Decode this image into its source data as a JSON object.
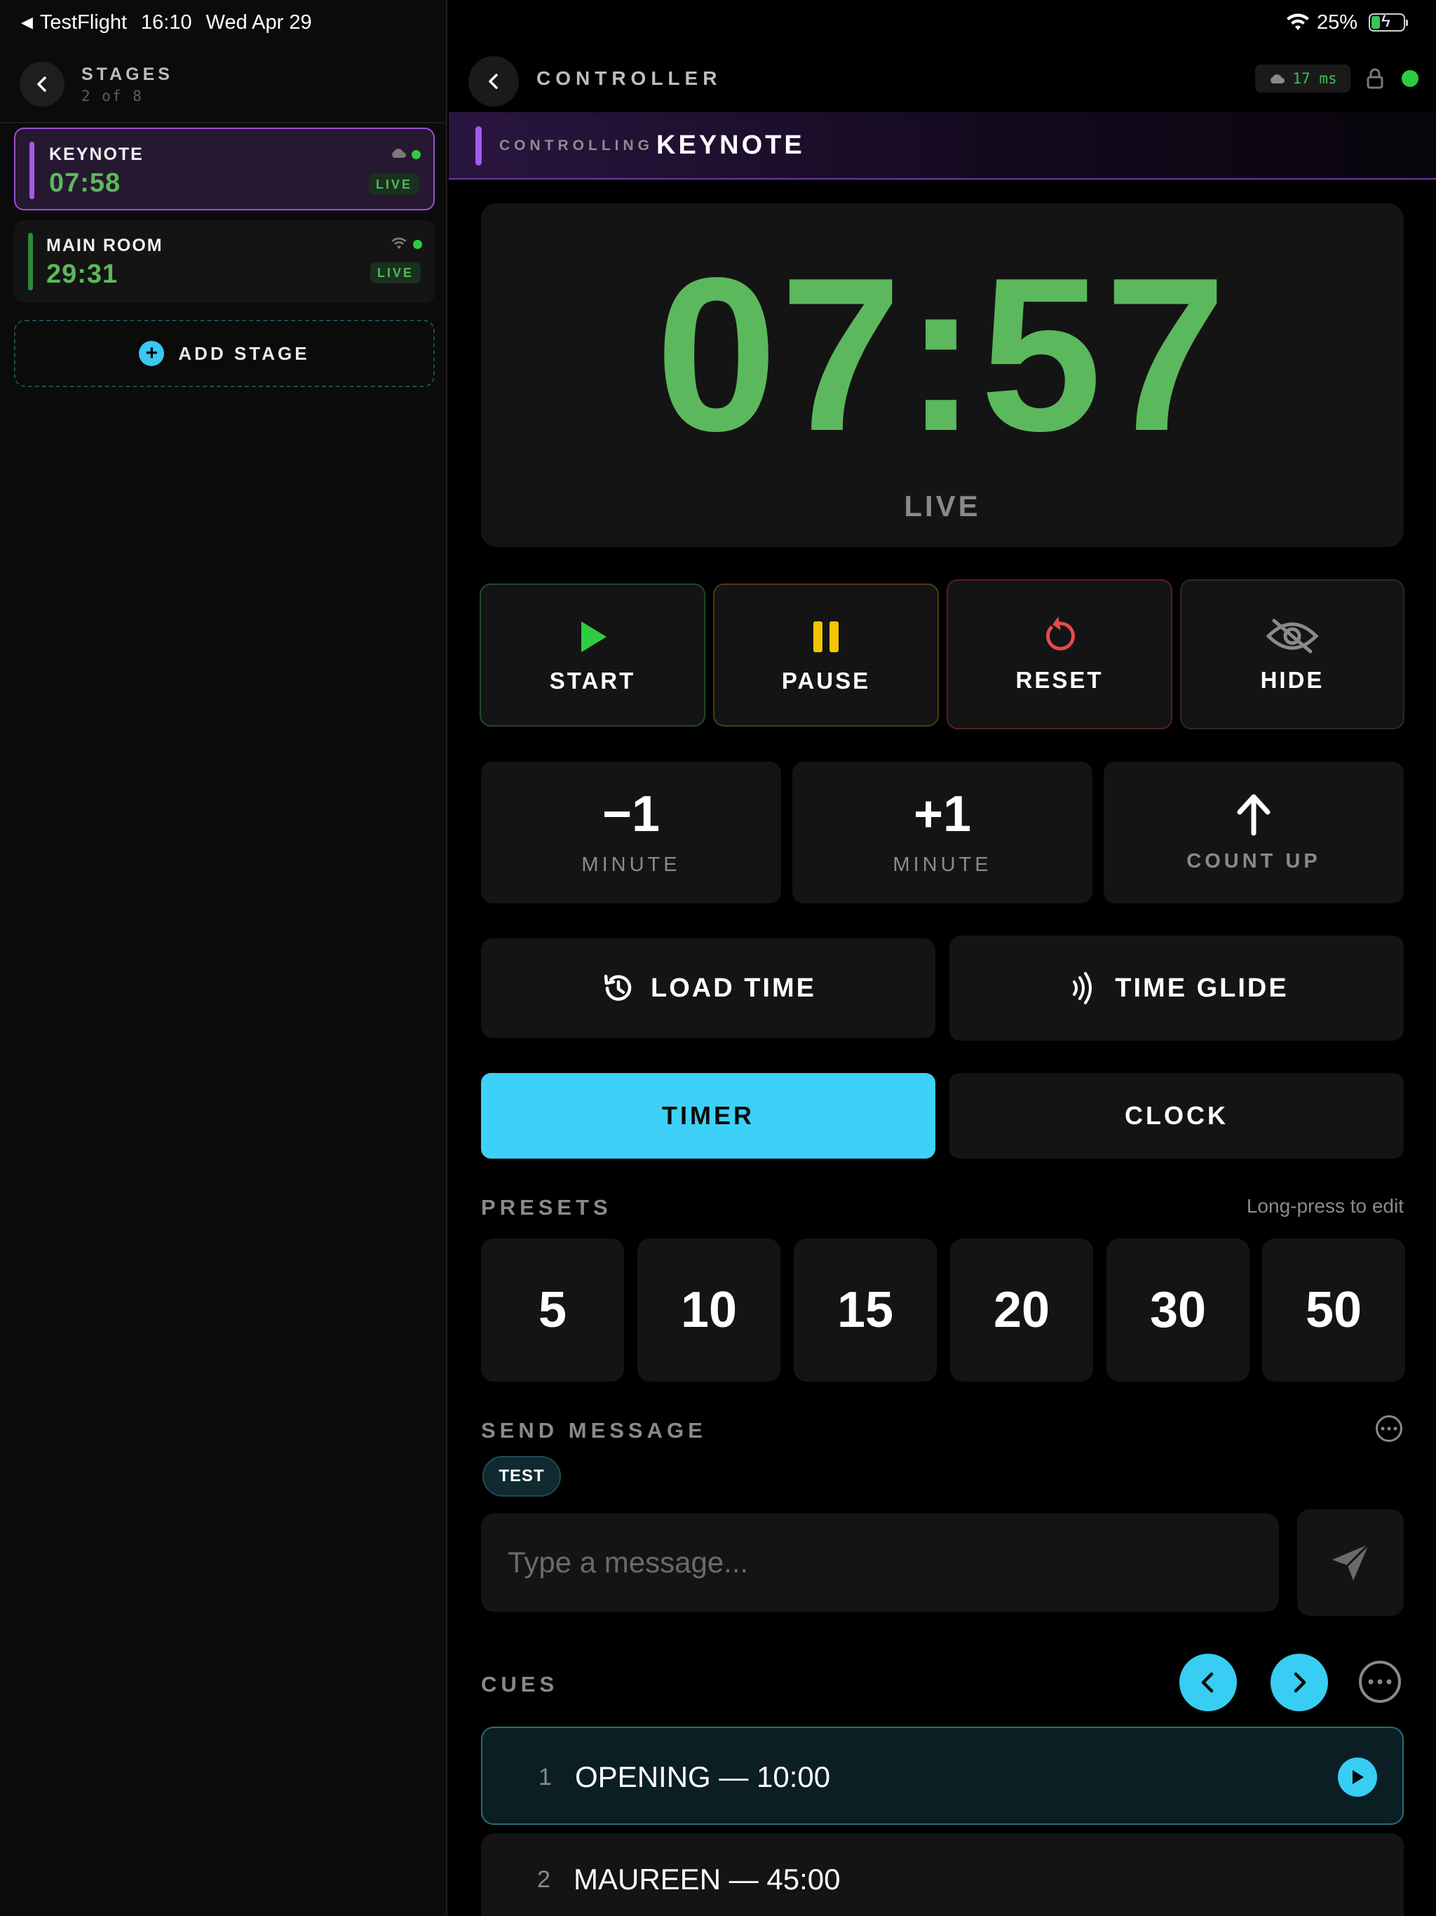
{
  "status_bar": {
    "back_app": "TestFlight",
    "time": "16:10",
    "date": "Wed Apr 29",
    "battery": "25%"
  },
  "sidebar": {
    "title": "STAGES",
    "count": "2 of 8",
    "stages": [
      {
        "name": "KEYNOTE",
        "time": "07:58",
        "badge": "LIVE",
        "connection_icon": "cloud-icon",
        "accent": "#a45ae8"
      },
      {
        "name": "MAIN ROOM",
        "time": "29:31",
        "badge": "LIVE",
        "connection_icon": "wifi-icon",
        "accent": "#2e8b3a"
      }
    ],
    "add_stage_label": "ADD STAGE"
  },
  "header": {
    "title": "CONTROLLER",
    "latency": "17 ms"
  },
  "controlling": {
    "label": "CONTROLLING",
    "stage_name": "KEYNOTE"
  },
  "timer": {
    "value": "07:57",
    "status": "LIVE"
  },
  "controls": {
    "start": "START",
    "pause": "PAUSE",
    "reset": "RESET",
    "hide": "HIDE"
  },
  "adjust": {
    "minus": {
      "value": "−1",
      "label": "MINUTE"
    },
    "plus": {
      "value": "+1",
      "label": "MINUTE"
    },
    "count_up": "COUNT UP"
  },
  "actions": {
    "load_time": "LOAD TIME",
    "time_glide": "TIME GLIDE"
  },
  "mode": {
    "timer": "TIMER",
    "clock": "CLOCK",
    "selected": "TIMER"
  },
  "presets": {
    "title": "PRESETS",
    "hint": "Long-press to edit",
    "values": [
      "5",
      "10",
      "15",
      "20",
      "30",
      "50"
    ]
  },
  "message": {
    "title": "SEND MESSAGE",
    "chip": "TEST",
    "placeholder": "Type a message..."
  },
  "cues": {
    "title": "CUES",
    "items": [
      {
        "num": "1",
        "label": "OPENING — 10:00"
      },
      {
        "num": "2",
        "label": "MAUREEN — 45:00"
      }
    ]
  },
  "colors": {
    "timer_green": "#5cb85c",
    "accent_cyan": "#38cdf3",
    "keynote_purple": "#a45ae8",
    "start_green": "#2ecc40",
    "pause_yellow": "#f5c400",
    "reset_red": "#e84a4a"
  }
}
